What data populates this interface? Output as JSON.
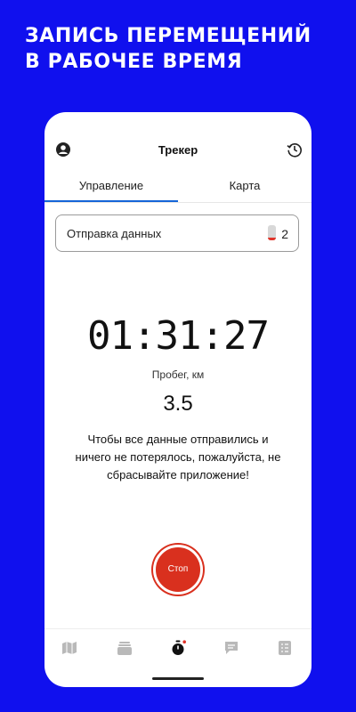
{
  "promo": {
    "headline_line1": "ЗАПИСЬ ПЕРЕМЕЩЕНИЙ",
    "headline_line2": "В РАБОЧЕЕ ВРЕМЯ"
  },
  "header": {
    "title": "Трекер",
    "left_icon": "profile-icon",
    "right_icon": "history-icon"
  },
  "tabs": [
    {
      "label": "Управление",
      "active": true
    },
    {
      "label": "Карта",
      "active": false
    }
  ],
  "send_card": {
    "label": "Отправка данных",
    "icon": "battery-icon",
    "count": "2"
  },
  "tracker": {
    "timer": "01:31:27",
    "mileage_label": "Пробег, км",
    "mileage_value": "3.5"
  },
  "note": {
    "line1": "Чтобы все данные отправились и",
    "line2": "ничего не потерялось, пожалуйста, не",
    "line3": "сбрасывайте приложение!"
  },
  "stop_button": {
    "label": "Стоп"
  },
  "bottom_nav": [
    {
      "icon": "map-icon"
    },
    {
      "icon": "stack-icon"
    },
    {
      "icon": "stopwatch-icon",
      "active": true
    },
    {
      "icon": "chat-icon"
    },
    {
      "icon": "list-icon"
    }
  ],
  "colors": {
    "background": "#1010ee",
    "accent": "#d9301e",
    "tab_indicator": "#1565d8",
    "nav_icon": "#b9b9b9"
  }
}
